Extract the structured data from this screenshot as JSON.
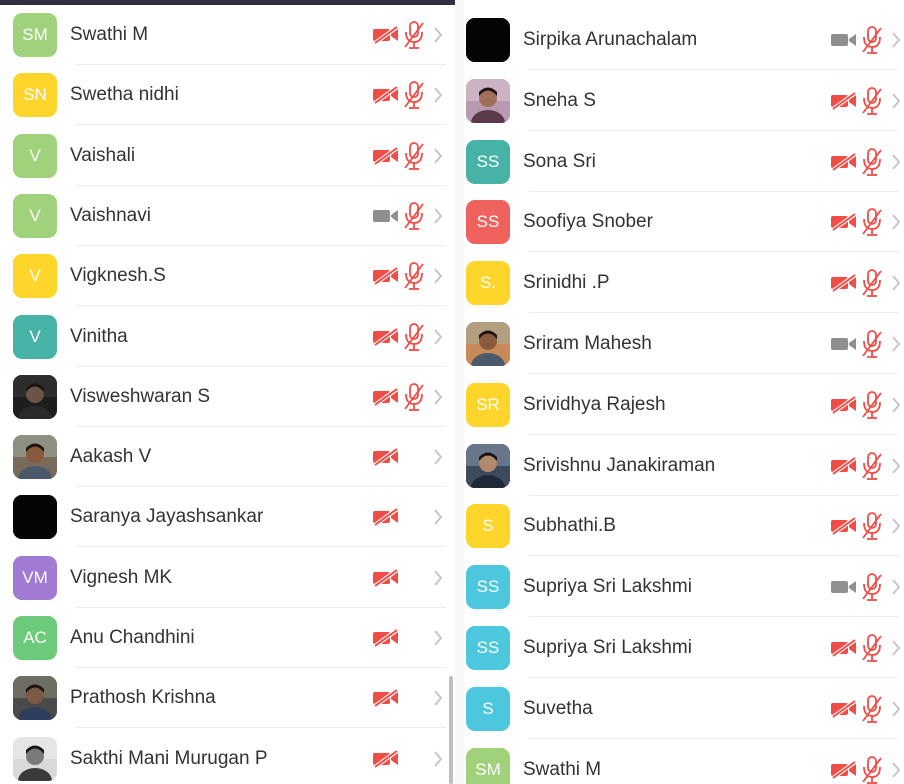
{
  "colors": {
    "muted_red": "#f24c46",
    "camera_on_gray": "#8f8f8f",
    "chevron_gray": "#c3c3c3",
    "avatar_green": "#9fd27a",
    "avatar_yellow": "#fdd52b",
    "avatar_teal": "#47b3a6",
    "avatar_salmon": "#f0625d",
    "avatar_cyan": "#4cc7dd",
    "avatar_purple": "#a07ad3",
    "avatar_green_dark": "#6ccb7b"
  },
  "left_list": [
    {
      "initials": "SM",
      "name": "Swathi M",
      "avatar_color": "#9fd27a",
      "video": "off",
      "audio": "muted"
    },
    {
      "initials": "SN",
      "name": "Swetha nidhi",
      "avatar_color": "#fdd52b",
      "video": "off",
      "audio": "muted"
    },
    {
      "initials": "V",
      "name": "Vaishali",
      "avatar_color": "#9fd27a",
      "video": "off",
      "audio": "muted"
    },
    {
      "initials": "V",
      "name": "Vaishnavi",
      "avatar_color": "#9fd27a",
      "video": "on",
      "audio": "muted"
    },
    {
      "initials": "V",
      "name": "Vigknesh.S",
      "avatar_color": "#fdd52b",
      "video": "off",
      "audio": "muted"
    },
    {
      "initials": "V",
      "name": "Vinitha",
      "avatar_color": "#47b3a6",
      "video": "off",
      "audio": "muted"
    },
    {
      "initials": "",
      "name": "Visweshwaran S",
      "avatar_color": "#1d1d1d",
      "photo": "dark-portrait",
      "video": "off",
      "audio": "muted"
    },
    {
      "initials": "",
      "name": "Aakash V",
      "avatar_color": "#7a6a5c",
      "photo": "outdoor-portrait",
      "video": "off",
      "audio": "none"
    },
    {
      "initials": "",
      "name": "Saranya Jayashsankar",
      "avatar_color": "#050505",
      "photo": "black",
      "video": "off",
      "audio": "none"
    },
    {
      "initials": "VM",
      "name": "Vignesh MK",
      "avatar_color": "#a07ad3",
      "video": "off",
      "audio": "none"
    },
    {
      "initials": "AC",
      "name": "Anu Chandhini",
      "avatar_color": "#6ccb7b",
      "video": "off",
      "audio": "none"
    },
    {
      "initials": "",
      "name": "Prathosh Krishna",
      "avatar_color": "#4a4a4a",
      "photo": "group-photo",
      "video": "off",
      "audio": "none"
    },
    {
      "initials": "",
      "name": "Sakthi Mani Murugan P",
      "avatar_color": "#d9d9d9",
      "photo": "bw-portrait",
      "video": "off",
      "audio": "none"
    }
  ],
  "right_list": [
    {
      "initials": "",
      "name": "Sirpika Arunachalam",
      "avatar_color": "#050505",
      "photo": "black",
      "video": "on",
      "audio": "muted"
    },
    {
      "initials": "",
      "name": "Sneha S",
      "avatar_color": "#b89ab0",
      "photo": "portrait-pink",
      "video": "off",
      "audio": "muted"
    },
    {
      "initials": "SS",
      "name": "Sona Sri",
      "avatar_color": "#47b3a6",
      "video": "off",
      "audio": "muted"
    },
    {
      "initials": "SS",
      "name": "Soofiya Snober",
      "avatar_color": "#f0625d",
      "video": "off",
      "audio": "muted"
    },
    {
      "initials": "S.",
      "name": "Srinidhi .P",
      "avatar_color": "#fdd52b",
      "video": "off",
      "audio": "muted"
    },
    {
      "initials": "",
      "name": "Sriram Mahesh",
      "avatar_color": "#c98a5a",
      "photo": "outdoor-portrait",
      "video": "on",
      "audio": "muted"
    },
    {
      "initials": "SR",
      "name": "Srividhya Rajesh",
      "avatar_color": "#fdd52b",
      "video": "off",
      "audio": "muted"
    },
    {
      "initials": "",
      "name": "Srivishnu Janakiraman",
      "avatar_color": "#3d4a5c",
      "photo": "film-poster",
      "video": "off",
      "audio": "muted"
    },
    {
      "initials": "S",
      "name": "Subhathi.B",
      "avatar_color": "#fdd52b",
      "video": "off",
      "audio": "muted"
    },
    {
      "initials": "SS",
      "name": "Supriya Sri Lakshmi",
      "avatar_color": "#4cc7dd",
      "video": "on",
      "audio": "muted"
    },
    {
      "initials": "SS",
      "name": "Supriya Sri Lakshmi",
      "avatar_color": "#4cc7dd",
      "video": "off",
      "audio": "muted"
    },
    {
      "initials": "S",
      "name": "Suvetha",
      "avatar_color": "#4cc7dd",
      "video": "off",
      "audio": "muted"
    },
    {
      "initials": "SM",
      "name": "Swathi M",
      "avatar_color": "#9fd27a",
      "video": "off",
      "audio": "muted"
    }
  ]
}
